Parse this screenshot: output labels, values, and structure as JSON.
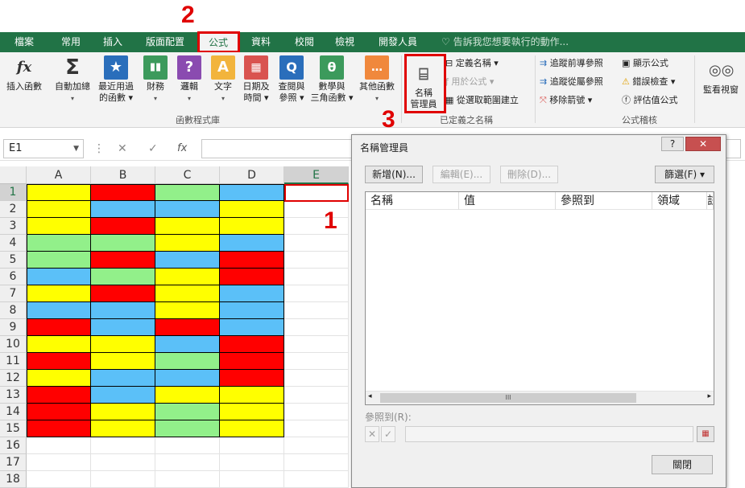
{
  "tabs": [
    "檔案",
    "常用",
    "插入",
    "版面配置",
    "公式",
    "資料",
    "校閱",
    "檢視",
    "開發人員"
  ],
  "tell_me": "告訴我您想要執行的動作...",
  "ribbon": {
    "insert_function": "插入函數",
    "autosum_1": "自動加總",
    "autosum_2": "▾",
    "recent_1": "最近用過",
    "recent_2": "的函數 ▾",
    "financial_1": "財務",
    "financial_2": "▾",
    "logical_1": "邏輯",
    "logical_2": "▾",
    "text_1": "文字",
    "text_2": "▾",
    "datetime_1": "日期及",
    "datetime_2": "時間 ▾",
    "lookup_1": "查閱與",
    "lookup_2": "參照 ▾",
    "math_1": "數學與",
    "math_2": "三角函數 ▾",
    "more_1": "其他函數",
    "more_2": "▾",
    "group_library": "函數程式庫",
    "name_manager_1": "名稱",
    "name_manager_2": "管理員",
    "define_name": "定義名稱 ▾",
    "use_in_formula": "用於公式 ▾",
    "create_from_sel": "從選取範圍建立",
    "group_defined": "已定義之名稱",
    "trace_precedents": "追蹤前導參照",
    "trace_dependents": "追蹤從屬參照",
    "remove_arrows": "移除箭號 ▾",
    "show_formulas": "顯示公式",
    "error_checking": "錯誤檢查 ▾",
    "evaluate_formula": "評估值公式",
    "group_auditing": "公式稽核",
    "watch_window": "監看視窗"
  },
  "formula_bar": {
    "name_box": "E1",
    "fx": "fx"
  },
  "grid": {
    "columns": [
      "A",
      "B",
      "C",
      "D",
      "E"
    ],
    "rows": [
      "1",
      "2",
      "3",
      "4",
      "5",
      "6",
      "7",
      "8",
      "9",
      "10",
      "11",
      "12",
      "13",
      "14",
      "15",
      "16",
      "17",
      "18"
    ],
    "palette": {
      "Y": "#ffff00",
      "R": "#ff0000",
      "B": "#5bc0f8",
      "G": "#92f08a"
    },
    "cells": [
      [
        "Y",
        "R",
        "G",
        "B"
      ],
      [
        "Y",
        "B",
        "B",
        "Y"
      ],
      [
        "Y",
        "R",
        "Y",
        "Y"
      ],
      [
        "G",
        "G",
        "Y",
        "B"
      ],
      [
        "G",
        "R",
        "B",
        "R"
      ],
      [
        "B",
        "G",
        "Y",
        "R"
      ],
      [
        "Y",
        "R",
        "Y",
        "B"
      ],
      [
        "B",
        "B",
        "Y",
        "B"
      ],
      [
        "R",
        "B",
        "R",
        "B"
      ],
      [
        "Y",
        "Y",
        "B",
        "R"
      ],
      [
        "R",
        "Y",
        "G",
        "R"
      ],
      [
        "Y",
        "B",
        "B",
        "R"
      ],
      [
        "R",
        "B",
        "Y",
        "Y"
      ],
      [
        "R",
        "Y",
        "G",
        "Y"
      ],
      [
        "R",
        "Y",
        "G",
        "Y"
      ]
    ]
  },
  "annotations": {
    "step1": "1",
    "step2": "2",
    "step3": "3"
  },
  "dialog": {
    "title": "名稱管理員",
    "help": "?",
    "new_btn": "新增(N)...",
    "edit_btn": "編輯(E)...",
    "delete_btn": "刪除(D)...",
    "filter_btn": "篩選(F) ▾",
    "col_name": "名稱",
    "col_value": "值",
    "col_refers": "參照到",
    "col_scope": "領域",
    "col_comment": "註",
    "scroll_thumb": "III",
    "refers_label": "參照到(R):",
    "close_btn": "關閉"
  }
}
